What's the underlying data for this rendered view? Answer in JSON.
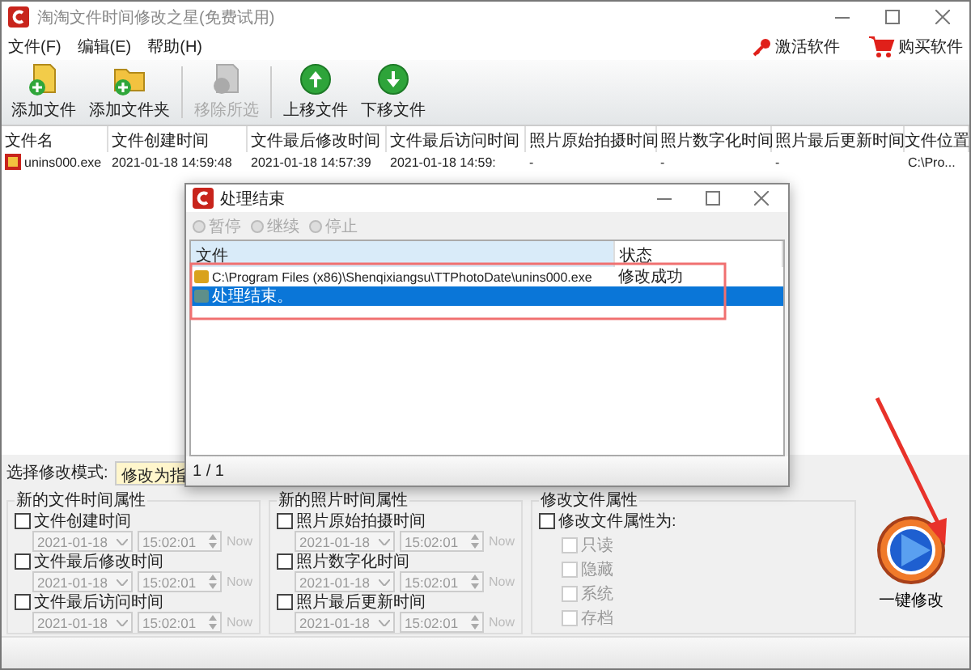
{
  "window": {
    "title": "淘淘文件时间修改之星(免费试用)"
  },
  "menu": [
    "文件(F)",
    "编辑(E)",
    "帮助(H)"
  ],
  "header_links": [
    {
      "label": "激活软件",
      "kind": "key"
    },
    {
      "label": "购买软件",
      "kind": "cart"
    }
  ],
  "toolbar": [
    {
      "label": "添加文件",
      "kind": "add-file",
      "disabled": false
    },
    {
      "label": "添加文件夹",
      "kind": "add-folder",
      "disabled": false
    },
    {
      "label": "移除所选",
      "kind": "remove",
      "disabled": true
    },
    {
      "label": "上移文件",
      "kind": "up",
      "disabled": false
    },
    {
      "label": "下移文件",
      "kind": "down",
      "disabled": false
    }
  ],
  "table": {
    "columns": [
      "文件名",
      "文件创建时间",
      "文件最后修改时间",
      "文件最后访问时间",
      "照片原始拍摄时间",
      "照片数字化时间",
      "照片最后更新时间",
      "文件位置"
    ],
    "rows": [
      {
        "cells": [
          "unins000.exe",
          "2021-01-18 14:59:48",
          "2021-01-18 14:57:39",
          "2021-01-18 14:59:",
          "-",
          "-",
          "-",
          "C:\\Pro..."
        ]
      }
    ]
  },
  "mode": {
    "label": "选择修改模式:",
    "value": "修改为指"
  },
  "time_groups": [
    {
      "title": "新的文件时间属性",
      "items": [
        {
          "label": "文件创建时间",
          "checked": false,
          "date": "2021-01-18",
          "time": "15:02:01",
          "now": "Now"
        },
        {
          "label": "文件最后修改时间",
          "checked": false,
          "date": "2021-01-18",
          "time": "15:02:01",
          "now": "Now"
        },
        {
          "label": "文件最后访问时间",
          "checked": false,
          "date": "2021-01-18",
          "time": "15:02:01",
          "now": "Now"
        }
      ]
    },
    {
      "title": "新的照片时间属性",
      "items": [
        {
          "label": "照片原始拍摄时间",
          "checked": false,
          "date": "2021-01-18",
          "time": "15:02:01",
          "now": "Now"
        },
        {
          "label": "照片数字化时间",
          "checked": false,
          "date": "2021-01-18",
          "time": "15:02:01",
          "now": "Now"
        },
        {
          "label": "照片最后更新时间",
          "checked": false,
          "date": "2021-01-18",
          "time": "15:02:01",
          "now": "Now"
        }
      ]
    }
  ],
  "attr_group": {
    "title": "修改文件属性",
    "master": {
      "label": "修改文件属性为:",
      "checked": false
    },
    "options": [
      {
        "label": "只读",
        "checked": false,
        "disabled": true
      },
      {
        "label": "隐藏",
        "checked": false,
        "disabled": true
      },
      {
        "label": "系统",
        "checked": false,
        "disabled": true
      },
      {
        "label": "存档",
        "checked": false,
        "disabled": true
      }
    ]
  },
  "run_button": {
    "label": "一键修改"
  },
  "dialog": {
    "title": "处理结束",
    "toolbar": [
      {
        "label": "暂停",
        "disabled": true
      },
      {
        "label": "继续",
        "disabled": true
      },
      {
        "label": "停止",
        "disabled": true
      }
    ],
    "columns": [
      "文件",
      "状态"
    ],
    "rows": [
      {
        "file": "C:\\Program Files (x86)\\Shenqixiangsu\\TTPhotoDate\\unins000.exe",
        "status": "修改成功",
        "kind": "file",
        "selected": false
      },
      {
        "file": "处理结束。",
        "kind": "info",
        "selected": true
      }
    ],
    "status": "1 / 1"
  }
}
